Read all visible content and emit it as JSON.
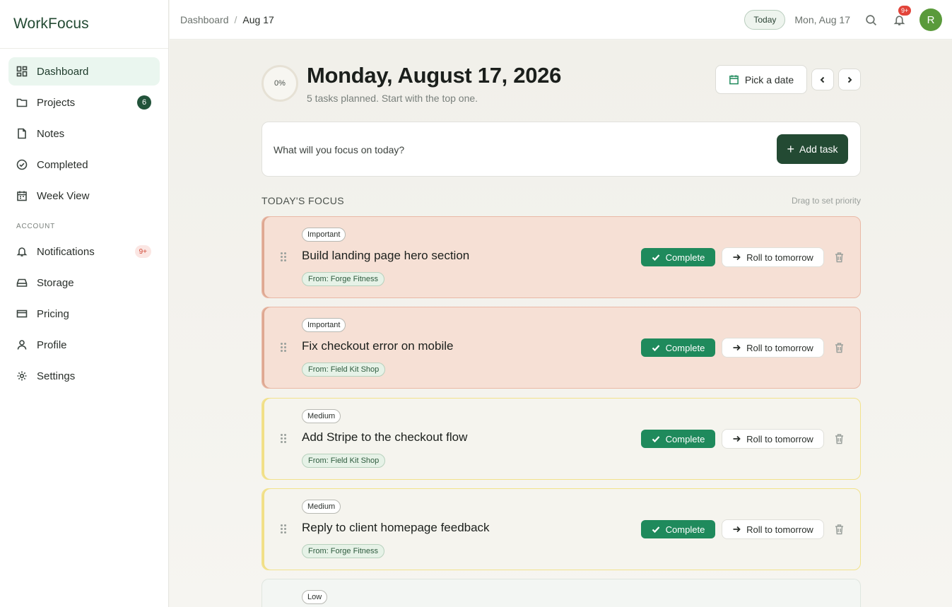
{
  "app": {
    "name": "WorkFocus"
  },
  "sidebar": {
    "items": [
      {
        "label": "Dashboard",
        "icon": "dashboard-icon",
        "active": true
      },
      {
        "label": "Projects",
        "icon": "folder-icon",
        "badge": "6"
      },
      {
        "label": "Notes",
        "icon": "note-icon"
      },
      {
        "label": "Completed",
        "icon": "check-circle-icon"
      },
      {
        "label": "Week View",
        "icon": "calendar-icon"
      }
    ],
    "account_label": "ACCOUNT",
    "account_items": [
      {
        "label": "Notifications",
        "icon": "bell-icon",
        "badge": "9+"
      },
      {
        "label": "Storage",
        "icon": "storage-icon"
      },
      {
        "label": "Pricing",
        "icon": "credit-card-icon"
      },
      {
        "label": "Profile",
        "icon": "user-icon"
      },
      {
        "label": "Settings",
        "icon": "gear-icon"
      }
    ]
  },
  "topbar": {
    "breadcrumb": [
      "Dashboard",
      "Aug 17"
    ],
    "separator": "/",
    "today_label": "Today",
    "date_label": "Mon, Aug 17",
    "notification_badge": "9+",
    "avatar_initial": "R"
  },
  "header": {
    "progress": "0%",
    "title": "Monday, August 17, 2026",
    "subtitle": "5 tasks planned. Start with the top one.",
    "pick_date_label": "Pick a date"
  },
  "focus_input": {
    "placeholder": "What will you focus on today?",
    "add_label": "Add task"
  },
  "section": {
    "title": "TODAY'S FOCUS",
    "hint": "Drag to set priority"
  },
  "actions": {
    "complete_label": "Complete",
    "roll_label": "Roll to tomorrow"
  },
  "tasks": [
    {
      "priority": "Important",
      "title": "Build landing page hero section",
      "source": "From: Forge Fitness"
    },
    {
      "priority": "Important",
      "title": "Fix checkout error on mobile",
      "source": "From: Field Kit Shop"
    },
    {
      "priority": "Medium",
      "title": "Add Stripe to the checkout flow",
      "source": "From: Field Kit Shop"
    },
    {
      "priority": "Medium",
      "title": "Reply to client homepage feedback",
      "source": "From: Forge Fitness"
    },
    {
      "priority": "Low"
    }
  ],
  "colors": {
    "brand": "#234a33",
    "accent_green": "#1f8a5c",
    "important_bg": "#f6e0d5",
    "medium_border": "#f2e28c",
    "badge_red": "#e2443a"
  }
}
